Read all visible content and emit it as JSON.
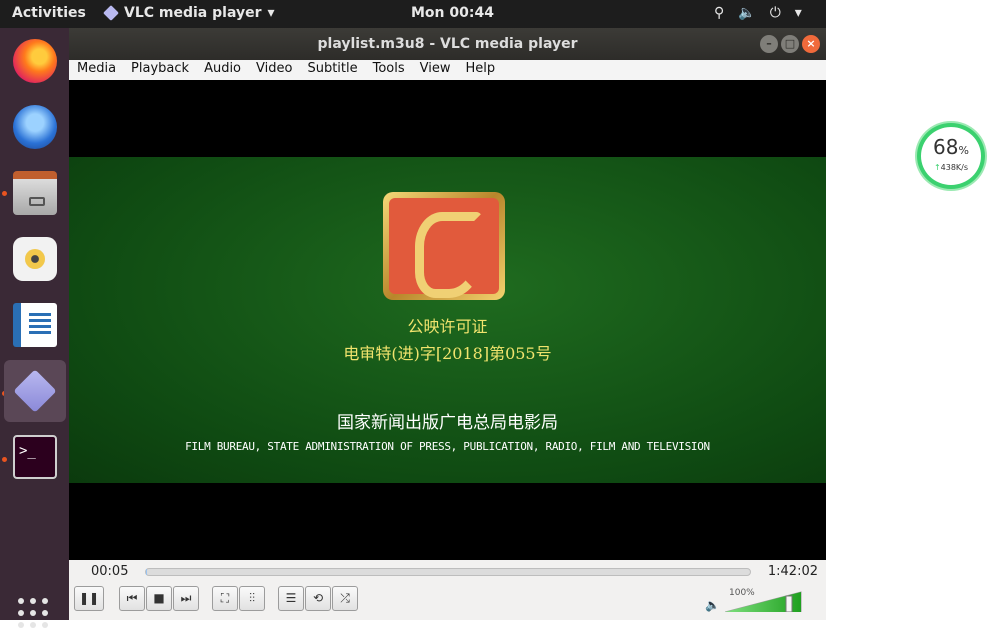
{
  "topbar": {
    "activities": "Activities",
    "app_name": "VLC media player",
    "clock": "Mon 00:44",
    "network_glyph": "⚲",
    "volume_glyph": "🔈",
    "power_glyph": "⏻",
    "menu_arrow": "▾"
  },
  "window": {
    "title": "playlist.m3u8 - VLC media player",
    "menu": [
      "Media",
      "Playback",
      "Audio",
      "Video",
      "Subtitle",
      "Tools",
      "View",
      "Help"
    ]
  },
  "video": {
    "line1": "公映许可证",
    "line2": "电审特(进)字[2018]第055号",
    "line3": "国家新闻出版广电总局电影局",
    "line4": "FILM BUREAU, STATE ADMINISTRATION OF PRESS, PUBLICATION, RADIO, FILM AND TELEVISION"
  },
  "controls": {
    "time_current": "00:05",
    "time_total": "1:42:02",
    "progress_fraction": 0.001,
    "volume_label": "100%",
    "volume_fraction": 1.0,
    "buttons": {
      "pause": "❚❚",
      "prev": "⏮",
      "stop": "■",
      "next": "⏭",
      "fullscreen": "⛶",
      "ext_settings": "⫶⫶",
      "playlist": "☰",
      "loop": "⟲",
      "random": "⤮"
    }
  },
  "net_widget": {
    "percent": "68",
    "percent_unit": "%",
    "speed_arrow": "↑",
    "speed": "438K/s"
  },
  "dock": {
    "terminal_glyph": ">_"
  },
  "colors": {
    "accent": "#e95420",
    "video_green": "#0f4a12",
    "widget_green": "#3bd16f"
  }
}
